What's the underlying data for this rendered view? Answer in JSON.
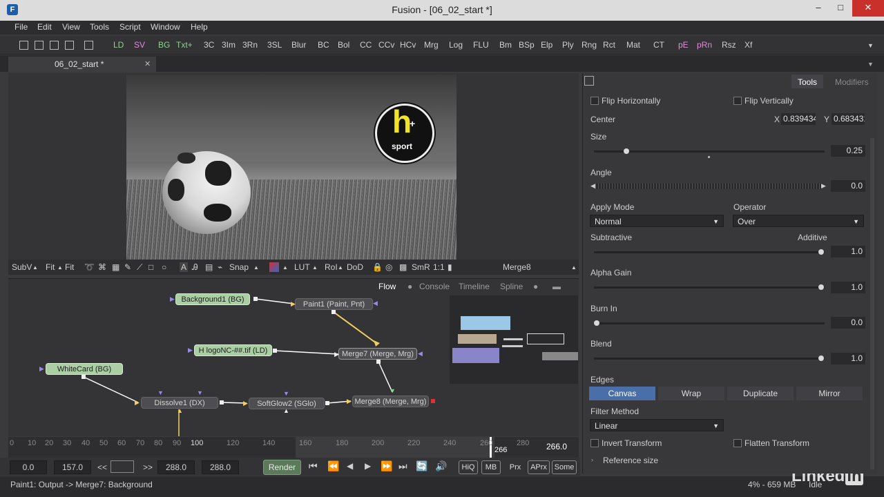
{
  "window": {
    "title": "Fusion - [06_02_start *]",
    "min": "–",
    "max": "□",
    "close": "✕"
  },
  "menu": [
    "File",
    "Edit",
    "View",
    "Tools",
    "Script",
    "Window",
    "Help"
  ],
  "toolbar": {
    "green": [
      "LD",
      "BG",
      "Txt+"
    ],
    "pink": [
      "SV",
      "pE",
      "pRn"
    ],
    "items": [
      "3C",
      "3Im",
      "3Rn",
      "3SL",
      "Blur",
      "BC",
      "Bol",
      "CC",
      "CCv",
      "HCv",
      "Mrg",
      "Log",
      "FLU",
      "Bm",
      "BSp",
      "Elp",
      "Ply",
      "Rng",
      "Rct",
      "Mat",
      "CT",
      "Rsz",
      "Xf"
    ]
  },
  "doc_tab": {
    "label": "06_02_start *",
    "close": "✕"
  },
  "logo": {
    "letter": "h",
    "word": "sport",
    "plus": "+"
  },
  "view_tools": {
    "subv": "SubV",
    "fit1": "Fit",
    "fit2": "Fit",
    "snap": "Snap",
    "lut": "LUT",
    "roi": "RoI",
    "dod": "DoD",
    "smr": "SmR",
    "ratio": "1:1",
    "node": "Merge8"
  },
  "flow_tabs": [
    "Flow",
    "Console",
    "Timeline",
    "Spline"
  ],
  "nodes": {
    "background1": "Background1  (BG)",
    "paint1": "Paint1  (Paint, Pnt)",
    "hlogo": "H logoNC-##.tif  (LD)",
    "merge7": "Merge7  (Merge, Mrg)",
    "whitecard": "WhiteCard  (BG)",
    "dissolve1": "Dissolve1  (DX)",
    "softglow2": "SoftGlow2  (SGlo)",
    "merge8": "Merge8  (Merge, Mrg)"
  },
  "timeline": {
    "ticks": [
      "0",
      "10",
      "20",
      "30",
      "40",
      "50",
      "60",
      "70",
      "80",
      "90",
      "100",
      "120",
      "140",
      "160",
      "180",
      "200",
      "220",
      "240",
      "260",
      "280"
    ],
    "current": "266",
    "current_display": "266.0"
  },
  "transport": {
    "start": "0.0",
    "render_start": "157.0",
    "prev": "<<",
    "next": ">>",
    "render_end": "288.0",
    "end": "288.0",
    "render_button": "Render",
    "hiq": "HiQ",
    "mb": "MB",
    "prx": "Prx",
    "aprx": "APrx",
    "some": "Some"
  },
  "status": {
    "left": "Paint1: Output -> Merge7: Background",
    "right": "4% - 659 MB",
    "state": "Idle",
    "brand": "Linked",
    "brand_in": "in"
  },
  "inspector": {
    "tabs": [
      "Tools",
      "Modifiers"
    ],
    "flip_h": "Flip Horizontally",
    "flip_v": "Flip Vertically",
    "center_label": "Center",
    "x_label": "X",
    "x_value": "0.839434",
    "y_label": "Y",
    "y_value": "0.683431",
    "size_label": "Size",
    "size_value": "0.25",
    "size_fraction": 0.13,
    "angle_label": "Angle",
    "angle_value": "0.0",
    "apply_mode_label": "Apply Mode",
    "apply_mode_value": "Normal",
    "operator_label": "Operator",
    "operator_value": "Over",
    "subtractive_label": "Subtractive",
    "additive_label": "Additive",
    "sub_add_value": "1.0",
    "alpha_gain_label": "Alpha Gain",
    "alpha_gain_value": "1.0",
    "burn_in_label": "Burn In",
    "burn_in_value": "0.0",
    "blend_label": "Blend",
    "blend_value": "1.0",
    "edges_label": "Edges",
    "edges": [
      "Canvas",
      "Wrap",
      "Duplicate",
      "Mirror"
    ],
    "filter_method_label": "Filter Method",
    "filter_method_value": "Linear",
    "invert_transform": "Invert Transform",
    "flatten_transform": "Flatten Transform",
    "reference_size": "Reference size"
  }
}
